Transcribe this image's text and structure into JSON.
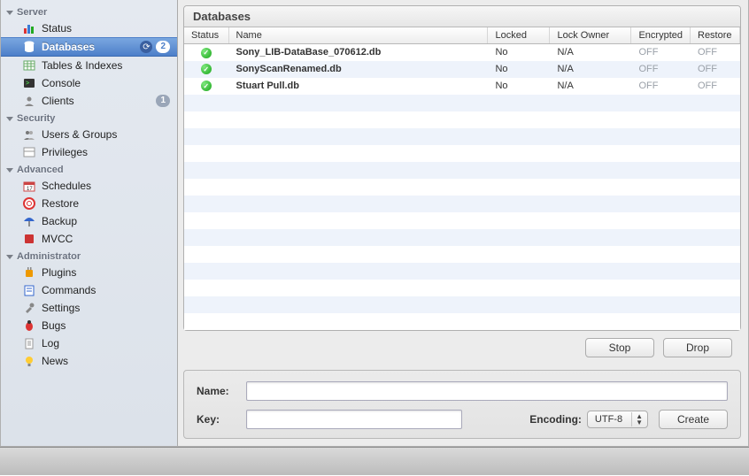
{
  "sidebar": {
    "groups": [
      {
        "title": "Server",
        "items": [
          {
            "label": "Status",
            "icon": "bar-chart-icon"
          },
          {
            "label": "Databases",
            "icon": "database-icon",
            "selected": true,
            "badge": "2",
            "refresh": true
          },
          {
            "label": "Tables & Indexes",
            "icon": "table-icon"
          },
          {
            "label": "Console",
            "icon": "console-icon"
          },
          {
            "label": "Clients",
            "icon": "clients-icon",
            "badge2": "1"
          }
        ]
      },
      {
        "title": "Security",
        "items": [
          {
            "label": "Users & Groups",
            "icon": "users-icon"
          },
          {
            "label": "Privileges",
            "icon": "privileges-icon"
          }
        ]
      },
      {
        "title": "Advanced",
        "items": [
          {
            "label": "Schedules",
            "icon": "calendar-icon"
          },
          {
            "label": "Restore",
            "icon": "lifebuoy-icon"
          },
          {
            "label": "Backup",
            "icon": "umbrella-icon"
          },
          {
            "label": "MVCC",
            "icon": "mvcc-icon"
          }
        ]
      },
      {
        "title": "Administrator",
        "items": [
          {
            "label": "Plugins",
            "icon": "plugin-icon"
          },
          {
            "label": "Commands",
            "icon": "commands-icon"
          },
          {
            "label": "Settings",
            "icon": "wrench-icon"
          },
          {
            "label": "Bugs",
            "icon": "bug-icon"
          },
          {
            "label": "Log",
            "icon": "log-icon"
          },
          {
            "label": "News",
            "icon": "bulb-icon"
          }
        ]
      }
    ]
  },
  "panel": {
    "title": "Databases",
    "columns": [
      "Status",
      "Name",
      "Locked",
      "Lock Owner",
      "Encrypted",
      "Restore"
    ],
    "rows": [
      {
        "name": "Sony_LIB-DataBase_070612.db",
        "locked": "No",
        "owner": "N/A",
        "encrypted": "OFF",
        "restore": "OFF"
      },
      {
        "name": "SonyScanRenamed.db",
        "locked": "No",
        "owner": "N/A",
        "encrypted": "OFF",
        "restore": "OFF"
      },
      {
        "name": "Stuart Pull.db",
        "locked": "No",
        "owner": "N/A",
        "encrypted": "OFF",
        "restore": "OFF"
      }
    ],
    "buttons": {
      "stop": "Stop",
      "drop": "Drop"
    }
  },
  "form": {
    "name_label": "Name:",
    "key_label": "Key:",
    "encoding_label": "Encoding:",
    "encoding_value": "UTF-8",
    "create_label": "Create"
  }
}
